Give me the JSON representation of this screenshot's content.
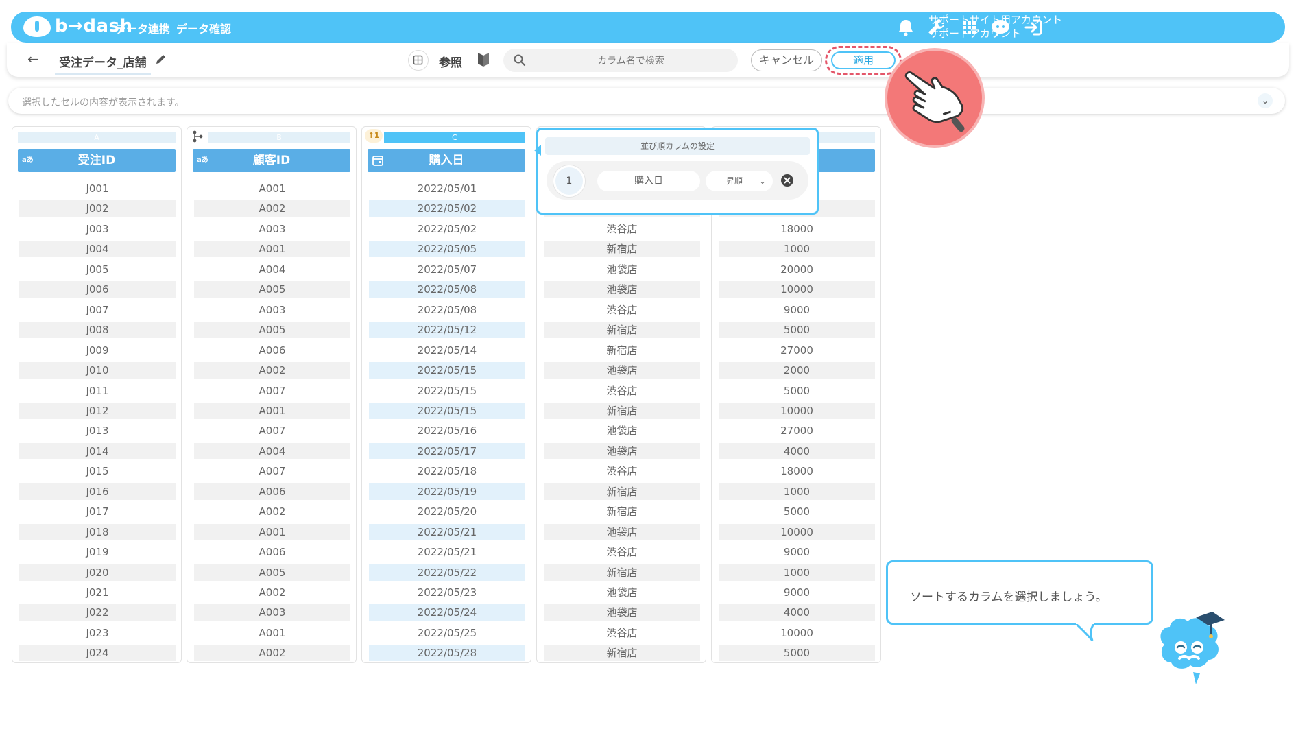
{
  "header": {
    "logo_text": "b→dash",
    "nav": [
      "データ連携",
      "データ確認"
    ],
    "account_line1": "サポートサイト用アカウント",
    "account_line2": "サポートアカウント",
    "icons": [
      "bell-icon",
      "wrench-icon",
      "apps-grid-icon",
      "chat-bot-icon",
      "logout-icon"
    ]
  },
  "toolbar": {
    "back_label": "←",
    "title": "受注データ_店舗",
    "ref_label": "参照",
    "search_placeholder": "カラム名で検索",
    "cancel_label": "キャンセル",
    "apply_label": "適用"
  },
  "cell_bar": {
    "text": "選択したセルの内容が表示されます。"
  },
  "columns": [
    {
      "letter": "A",
      "type_badge": "aあ",
      "header": "受注ID",
      "rows": [
        "J001",
        "J002",
        "J003",
        "J004",
        "J005",
        "J006",
        "J007",
        "J008",
        "J009",
        "J010",
        "J011",
        "J012",
        "J013",
        "J014",
        "J015",
        "J016",
        "J017",
        "J018",
        "J019",
        "J020",
        "J021",
        "J022",
        "J023",
        "J024"
      ]
    },
    {
      "letter": "B",
      "type_badge": "aあ",
      "header": "顧客ID",
      "rows": [
        "A001",
        "A002",
        "A003",
        "A001",
        "A004",
        "A005",
        "A003",
        "A005",
        "A006",
        "A002",
        "A007",
        "A001",
        "A007",
        "A004",
        "A007",
        "A006",
        "A002",
        "A001",
        "A006",
        "A005",
        "A002",
        "A003",
        "A001",
        "A002"
      ]
    },
    {
      "letter": "C",
      "sort_badge": "↑1",
      "header": "購入日",
      "rows": [
        "2022/05/01",
        "2022/05/02",
        "2022/05/02",
        "2022/05/05",
        "2022/05/07",
        "2022/05/08",
        "2022/05/08",
        "2022/05/12",
        "2022/05/14",
        "2022/05/15",
        "2022/05/15",
        "2022/05/15",
        "2022/05/16",
        "2022/05/17",
        "2022/05/18",
        "2022/05/19",
        "2022/05/20",
        "2022/05/21",
        "2022/05/21",
        "2022/05/22",
        "2022/05/23",
        "2022/05/24",
        "2022/05/25",
        "2022/05/28"
      ]
    },
    {
      "letter": "",
      "header": "",
      "rows": [
        "",
        "",
        "渋谷店",
        "新宿店",
        "池袋店",
        "池袋店",
        "渋谷店",
        "新宿店",
        "新宿店",
        "池袋店",
        "渋谷店",
        "新宿店",
        "池袋店",
        "池袋店",
        "渋谷店",
        "新宿店",
        "新宿店",
        "池袋店",
        "渋谷店",
        "新宿店",
        "池袋店",
        "池袋店",
        "渋谷店",
        "新宿店"
      ]
    },
    {
      "letter": "",
      "header": "",
      "rows": [
        "",
        "",
        "18000",
        "1000",
        "20000",
        "10000",
        "9000",
        "5000",
        "27000",
        "2000",
        "5000",
        "10000",
        "27000",
        "4000",
        "18000",
        "1000",
        "5000",
        "10000",
        "9000",
        "1000",
        "9000",
        "4000",
        "10000",
        "5000"
      ]
    }
  ],
  "sort_popover": {
    "title": "並び順カラムの設定",
    "number": "1",
    "field": "購入日",
    "order": "昇順"
  },
  "bubble": {
    "text": "ソートするカラムを選択しましょう。"
  },
  "colors": {
    "accent": "#4fc3f7",
    "header_blue": "#5aaee6",
    "highlight_red": "#e4576a"
  }
}
